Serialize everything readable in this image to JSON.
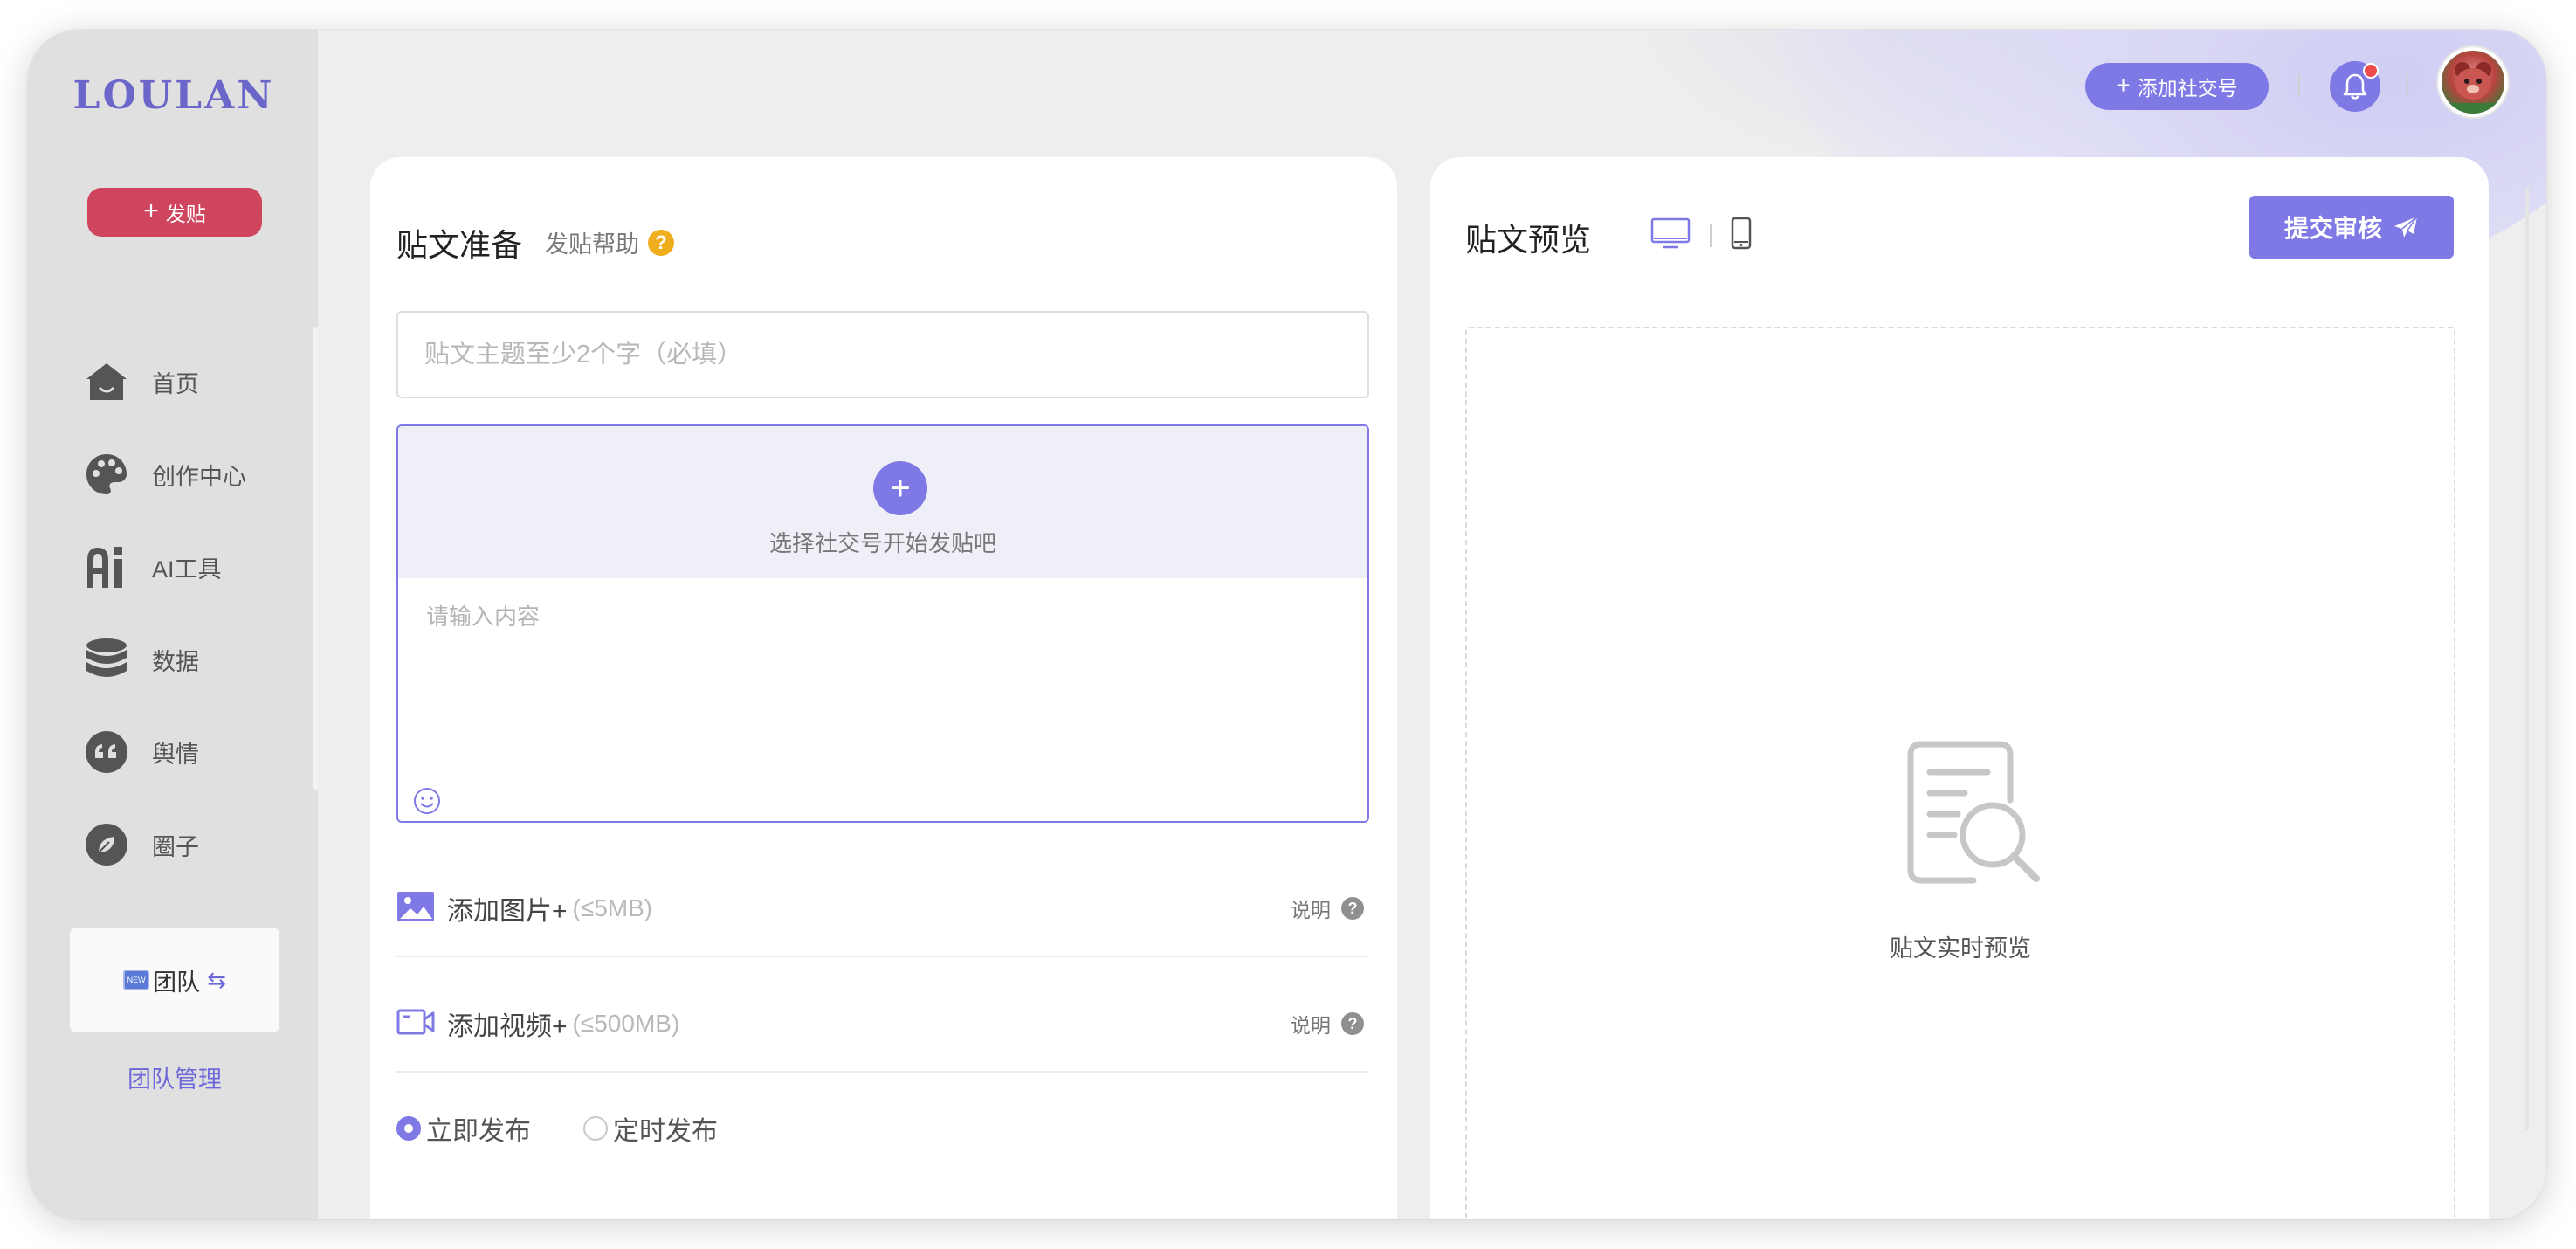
{
  "app": {
    "logo": "LOULAN",
    "post_button": "发贴",
    "nav": [
      {
        "label": "首页",
        "icon": "home-icon"
      },
      {
        "label": "创作中心",
        "icon": "palette-icon"
      },
      {
        "label": "AI工具",
        "icon": "ai-icon"
      },
      {
        "label": "数据",
        "icon": "database-icon"
      },
      {
        "label": "舆情",
        "icon": "quote-icon"
      },
      {
        "label": "圈子",
        "icon": "circle-leaf-icon"
      }
    ],
    "team": {
      "badge": "NEW",
      "label": "团队",
      "manage_link": "团队管理"
    }
  },
  "topbar": {
    "add_social_label": "添加社交号",
    "has_notification": true
  },
  "composer": {
    "title": "贴文准备",
    "help_link": "发贴帮助",
    "topic_placeholder": "贴文主题至少2个字（必填）",
    "select_account_hint": "选择社交号开始发贴吧",
    "content_placeholder": "请输入内容",
    "image_row": {
      "label": "添加图片+",
      "limit": "(≤5MB)",
      "note": "说明"
    },
    "video_row": {
      "label": "添加视频+",
      "limit": "(≤500MB)",
      "note": "说明"
    },
    "publish_options": [
      {
        "label": "立即发布",
        "selected": true
      },
      {
        "label": "定时发布",
        "selected": false
      }
    ]
  },
  "preview": {
    "title": "贴文预览",
    "submit_label": "提交审核",
    "empty_label": "贴文实时预览",
    "active_view": "desktop"
  },
  "colors": {
    "accent": "#7f79e6",
    "post_button": "#d0455e",
    "help_icon": "#f0ae1e",
    "notification_dot": "#ef4d4d"
  }
}
